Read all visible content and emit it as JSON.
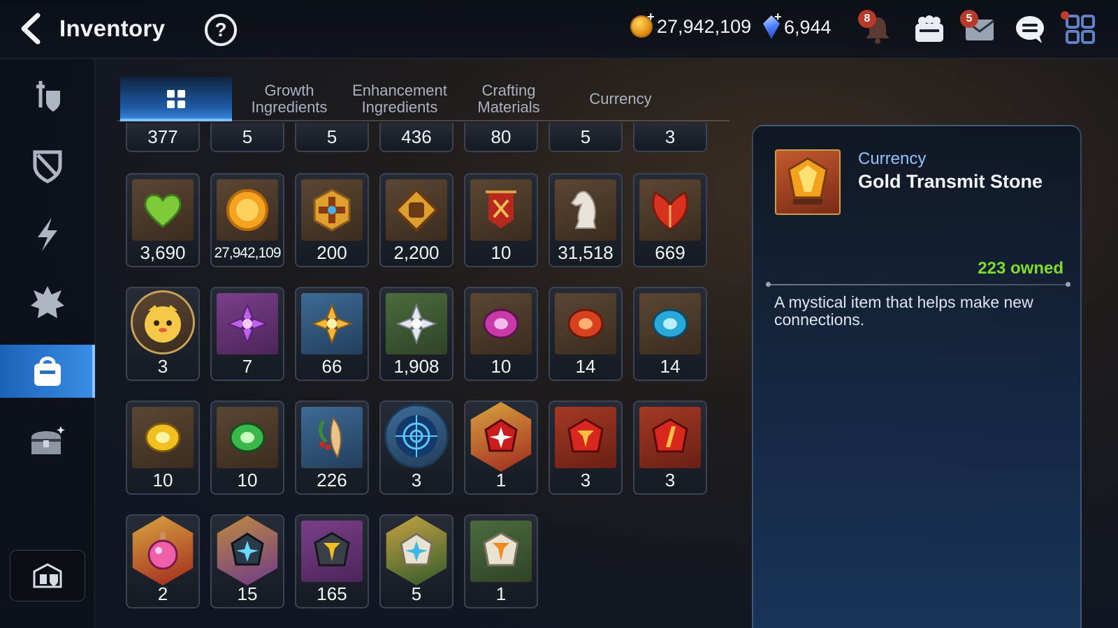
{
  "header": {
    "title": "Inventory",
    "help_symbol": "?",
    "plus_symbol": "+",
    "gold": "27,942,109",
    "crystals": "6,944",
    "notifications_badge": "8",
    "mail_badge": "5",
    "icons": [
      "back-arrow-icon",
      "help-icon",
      "gold-coin-icon",
      "crystal-gem-icon",
      "bell-icon",
      "friends-icon",
      "mail-icon",
      "chat-icon",
      "menu-grid-icon"
    ]
  },
  "sidebar": {
    "items": [
      {
        "icon": "equipment-icon",
        "active": false
      },
      {
        "icon": "artifact-icon",
        "active": false
      },
      {
        "icon": "energy-icon",
        "active": false
      },
      {
        "icon": "emblem-icon",
        "active": false
      },
      {
        "icon": "bag-icon",
        "active": true
      },
      {
        "icon": "chest-icon",
        "active": false
      }
    ],
    "bottom_icon": "storage-icon"
  },
  "tabs": [
    {
      "label": "",
      "icon": "grid-icon",
      "active": true
    },
    {
      "label": "Growth\nIngredients",
      "active": false
    },
    {
      "label": "Enhancement\nIngredients",
      "active": false
    },
    {
      "label": "Crafting\nMaterials",
      "active": false
    },
    {
      "label": "Currency",
      "active": false
    }
  ],
  "items": {
    "row0": [
      "377",
      "5",
      "5",
      "436",
      "80",
      "5",
      "3"
    ],
    "row1": [
      {
        "qty": "3,690",
        "icon": "green-heart-icon"
      },
      {
        "qty": "27,942,109",
        "icon": "gold-sun-coin-icon"
      },
      {
        "qty": "200",
        "icon": "gold-cross-medal-icon"
      },
      {
        "qty": "2,200",
        "icon": "fist-emblem-icon"
      },
      {
        "qty": "10",
        "icon": "war-banner-icon"
      },
      {
        "qty": "31,518",
        "icon": "chess-knight-icon"
      },
      {
        "qty": "669",
        "icon": "red-leaf-icon"
      }
    ],
    "row2": [
      {
        "qty": "3",
        "icon": "mascot-face-icon"
      },
      {
        "qty": "7",
        "icon": "purple-flower-icon"
      },
      {
        "qty": "66",
        "icon": "gold-flower-icon"
      },
      {
        "qty": "1,908",
        "icon": "silver-flower-icon"
      },
      {
        "qty": "10",
        "icon": "purple-rune-gem-icon"
      },
      {
        "qty": "14",
        "icon": "red-rune-gem-icon"
      },
      {
        "qty": "14",
        "icon": "cyan-rune-gem-icon"
      }
    ],
    "row3": [
      {
        "qty": "10",
        "icon": "yellow-rune-gem-icon"
      },
      {
        "qty": "10",
        "icon": "green-rune-gem-icon"
      },
      {
        "qty": "226",
        "icon": "root-herb-icon"
      },
      {
        "qty": "3",
        "icon": "blue-portal-icon"
      },
      {
        "qty": "1",
        "icon": "red-star-stone-icon"
      },
      {
        "qty": "3",
        "icon": "red-transmit-stone-icon"
      },
      {
        "qty": "3",
        "icon": "red-transmit-stone-alt-icon"
      }
    ],
    "row4": [
      {
        "qty": "2",
        "icon": "pink-potion-icon"
      },
      {
        "qty": "15",
        "icon": "blue-star-stone-icon"
      },
      {
        "qty": "165",
        "icon": "gold-transmit-stone-small-icon"
      },
      {
        "qty": "5",
        "icon": "star-stone-gold-frame-icon"
      },
      {
        "qty": "1",
        "icon": "white-transmit-stone-icon"
      }
    ]
  },
  "detail": {
    "category": "Currency",
    "name": "Gold Transmit Stone",
    "owned": "223 owned",
    "description": "A mystical item that helps make new connections.",
    "icon": "gold-transmit-stone-icon"
  },
  "colors": {
    "accent_blue": "#3c8ee6",
    "owned_green": "#7fdc2e",
    "category_blue": "#8fc3ff",
    "badge_red": "#b83a2a"
  }
}
